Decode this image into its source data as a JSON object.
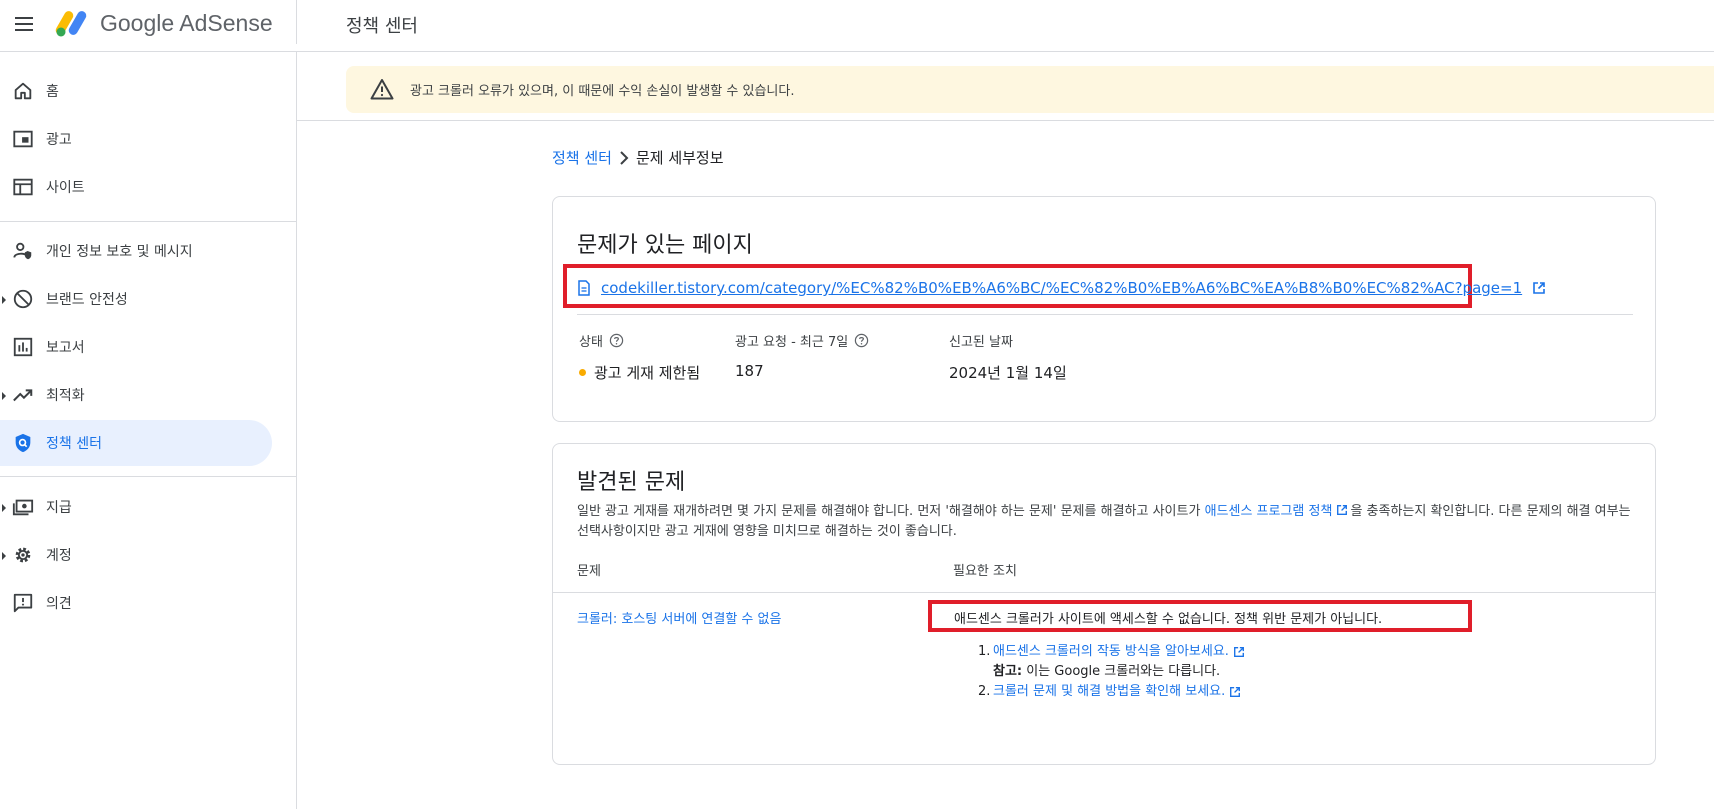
{
  "header": {
    "brand": "Google AdSense",
    "page_title": "정책 센터"
  },
  "sidebar": {
    "items": [
      {
        "label": "홈",
        "icon": "home-icon"
      },
      {
        "label": "광고",
        "icon": "ads-icon"
      },
      {
        "label": "사이트",
        "icon": "sites-icon"
      },
      {
        "label": "개인 정보 보호 및 메시지",
        "icon": "privacy-icon"
      },
      {
        "label": "브랜드 안전성",
        "icon": "block-icon"
      },
      {
        "label": "보고서",
        "icon": "reports-icon"
      },
      {
        "label": "최적화",
        "icon": "trending-icon"
      },
      {
        "label": "정책 센터",
        "icon": "shield-icon"
      },
      {
        "label": "지급",
        "icon": "payments-icon"
      },
      {
        "label": "계정",
        "icon": "gear-icon"
      },
      {
        "label": "의견",
        "icon": "feedback-icon"
      }
    ]
  },
  "banner": {
    "text": "광고 크롤러 오류가 있으며, 이 때문에 수익 손실이 발생할 수 있습니다."
  },
  "breadcrumb": {
    "parent": "정책 센터",
    "current": "문제 세부정보"
  },
  "page_card": {
    "title": "문제가 있는 페이지",
    "url": "codekiller.tistory.com/category/%EC%82%B0%EB%A6%BC/%EC%82%B0%EB%A6%BC%EA%B8%B0%EC%82%AC?page=1",
    "status_label": "상태",
    "status_value": "광고 게재 제한됨",
    "requests_label": "광고 요청 - 최근 7일",
    "requests_value": "187",
    "reported_label": "신고된 날짜",
    "reported_value": "2024년 1월 14일"
  },
  "issues_card": {
    "title": "발견된 문제",
    "desc_part1": "일반 광고 게재를 재개하려면 몇 가지 문제를 해결해야 합니다. 먼저 '해결해야 하는 문제' 문제를 해결하고 사이트가 ",
    "desc_link": "애드센스 프로그램 정책",
    "desc_part2": "을 충족하는지 확인합니다. 다른 문제의 해결 여부는 선택사항이지만 광고 게재에 영향을 미치므로 해결하는 것이 좋습니다.",
    "col_issue": "문제",
    "col_action": "필요한 조치",
    "issue_name": "크롤러: 호스팅 서버에 연결할 수 없음",
    "action_text": "애드센스 크롤러가 사이트에 액세스할 수 없습니다. 정책 위반 문제가 아닙니다.",
    "steps": [
      {
        "num": "1.",
        "link": "애드센스 크롤러의 작동 방식을 알아보세요."
      },
      {
        "num": "2.",
        "link": "크롤러 문제 및 해결 방법을 확인해 보세요."
      }
    ],
    "note_label": "참고:",
    "note_text": " 이는 Google 크롤러와는 다릅니다."
  },
  "colors": {
    "accent": "#1a73e8",
    "warning_bg": "#fef7e0",
    "status_dot": "#f9ab00",
    "highlight_red": "#e01e2a",
    "active_nav_bg": "#e8f0fe"
  }
}
